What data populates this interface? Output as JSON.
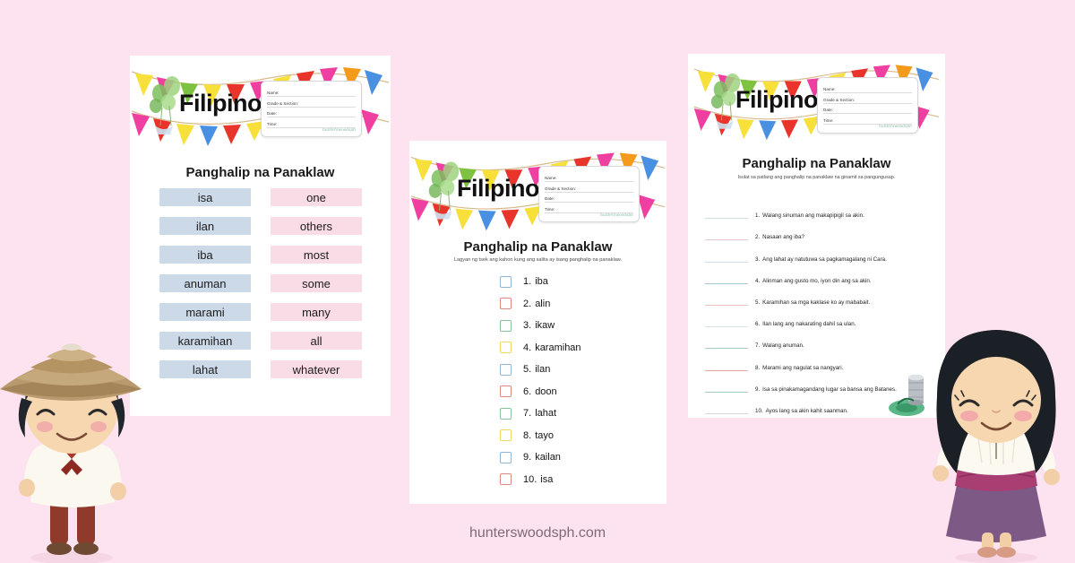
{
  "page": {
    "background_color": "#fde3ef",
    "footer_text": "hunterswoodsph.com"
  },
  "header": {
    "subject": "Filipino",
    "namebox": {
      "fields": [
        "Name:",
        "Grade & Section:",
        "Date:",
        "Time:"
      ],
      "signature": "hunterswoodsph"
    },
    "banner_colors": [
      "#f7e03a",
      "#e8342a",
      "#ef3fa0",
      "#4a90e2",
      "#7ec242",
      "#f49b1e"
    ]
  },
  "worksheets": [
    {
      "id": "word-match",
      "title": "Panghalip na Panaklaw",
      "subtitle": "",
      "left_color": "#ccd9e9",
      "right_color": "#fadce6",
      "pairs": [
        {
          "tagalog": "isa",
          "english": "one"
        },
        {
          "tagalog": "ilan",
          "english": "others"
        },
        {
          "tagalog": "iba",
          "english": "most"
        },
        {
          "tagalog": "anuman",
          "english": "some"
        },
        {
          "tagalog": "marami",
          "english": "many"
        },
        {
          "tagalog": "karamihan",
          "english": "all"
        },
        {
          "tagalog": "lahat",
          "english": "whatever"
        }
      ]
    },
    {
      "id": "checklist",
      "title": "Panghalip na Panaklaw",
      "subtitle": "Lagyan ng tsek ang kahon kung ang salita ay isang panghalip na panaklaw.",
      "items": [
        {
          "number": "1.",
          "word": "iba",
          "box_color": "#8fb8d8"
        },
        {
          "number": "2.",
          "word": "alin",
          "box_color": "#e08b80"
        },
        {
          "number": "3.",
          "word": "ikaw",
          "box_color": "#86c79a"
        },
        {
          "number": "4.",
          "word": "karamihan",
          "box_color": "#f0d862"
        },
        {
          "number": "5.",
          "word": "ilan",
          "box_color": "#8fb8d8"
        },
        {
          "number": "6.",
          "word": "doon",
          "box_color": "#e08b80"
        },
        {
          "number": "7.",
          "word": "lahat",
          "box_color": "#86c79a"
        },
        {
          "number": "8.",
          "word": "tayo",
          "box_color": "#f0d862"
        },
        {
          "number": "9.",
          "word": "kailan",
          "box_color": "#8fb8d8"
        },
        {
          "number": "10.",
          "word": "isa",
          "box_color": "#e08b80"
        }
      ]
    },
    {
      "id": "sentence-fill",
      "title": "Panghalip na Panaklaw",
      "subtitle": "Isulat sa patlang ang panghalip na panaklaw na ginamit sa pangungusap.",
      "items": [
        {
          "number": "1.",
          "sentence": "Walang sinuman ang makapipigil sa akin.",
          "line_color": "#cfe0d8"
        },
        {
          "number": "2.",
          "sentence": "Nasaan ang iba?",
          "line_color": "#e8cdc9"
        },
        {
          "number": "3.",
          "sentence": "Ang lahat ay natutuwa sa pagkamagalang ni Cara.",
          "line_color": "#cfdde6"
        },
        {
          "number": "4.",
          "sentence": "Alinman ang gusto mo, iyon din ang sa akin.",
          "line_color": "#a9c6d4"
        },
        {
          "number": "5.",
          "sentence": "Karamihan sa mga kaklase ko ay mababait.",
          "line_color": "#e8c5bd"
        },
        {
          "number": "6.",
          "sentence": "Ilan lang ang nakarating dahil sa ulan.",
          "line_color": "#d9e2dd"
        },
        {
          "number": "7.",
          "sentence": "Walang anuman.",
          "line_color": "#aac9cc"
        },
        {
          "number": "8.",
          "sentence": "Marami ang nagulat sa nangyari.",
          "line_color": "#e0a79e"
        },
        {
          "number": "9.",
          "sentence": "Isa sa pinakamagandang lugar sa bansa ang Batanes.",
          "line_color": "#a8ccb6"
        },
        {
          "number": "10.",
          "sentence": "Ayos lang sa akin kahit saanman.",
          "line_color": "#d8d8d8"
        }
      ],
      "decoration": "drum-and-leaf-illustration"
    }
  ],
  "mascots": [
    {
      "name": "boy-in-salakot",
      "side": "left"
    },
    {
      "name": "girl-in-filipiniana",
      "side": "right"
    }
  ]
}
